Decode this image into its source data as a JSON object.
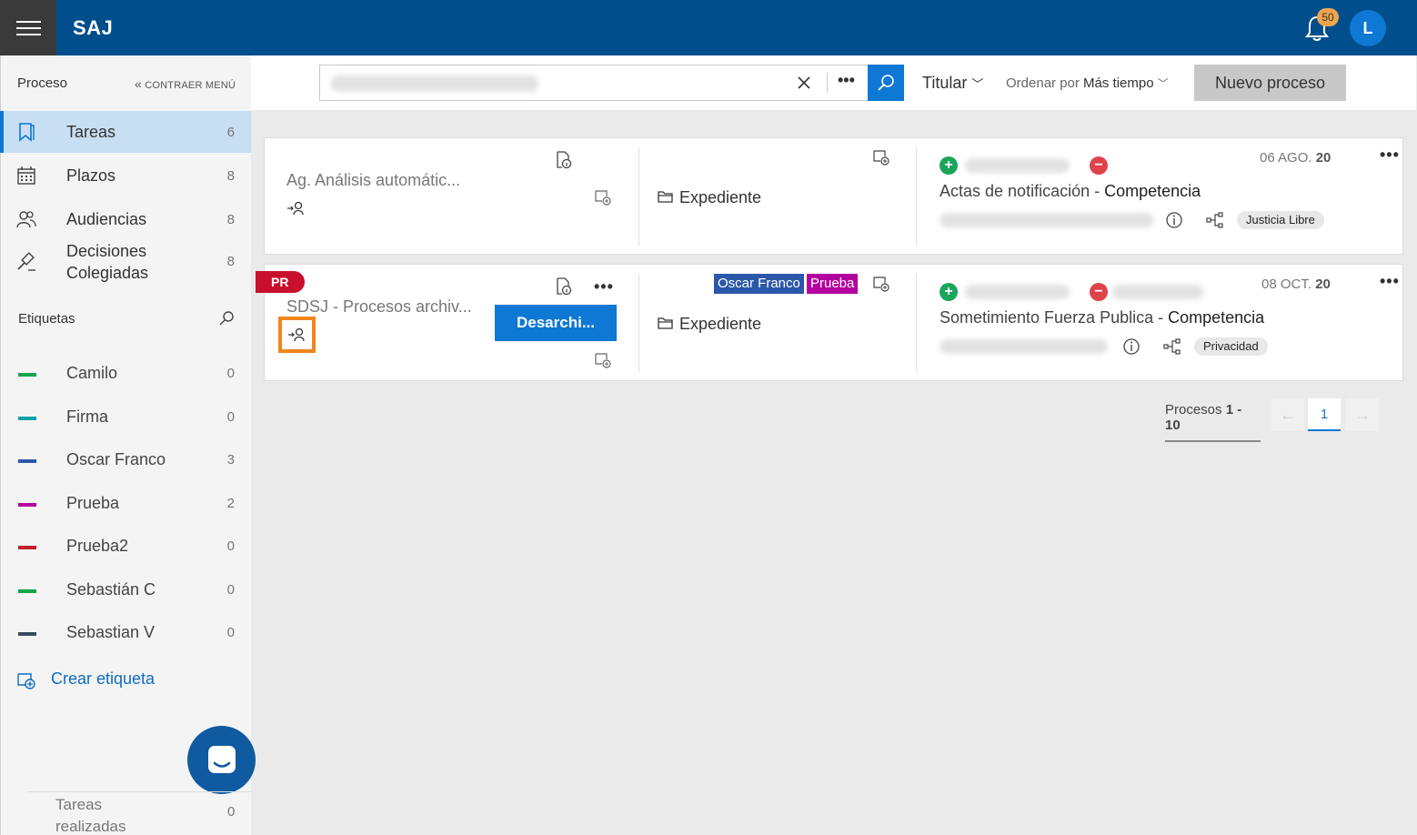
{
  "app": {
    "title": "SAJ",
    "notifications": "50",
    "user_initial": "L"
  },
  "sidebar": {
    "title": "Proceso",
    "collapse": "CONTRAER MENÚ",
    "nav": [
      {
        "label": "Tareas",
        "count": "6",
        "icon": "bookmark-icon"
      },
      {
        "label": "Plazos",
        "count": "8",
        "icon": "calendar-icon"
      },
      {
        "label": "Audiencias",
        "count": "8",
        "icon": "people-icon"
      },
      {
        "label": "Decisiones Colegiadas",
        "line1": "Decisiones",
        "line2": "Colegiadas",
        "count": "8",
        "icon": "gavel-icon"
      }
    ],
    "etiquetas_title": "Etiquetas",
    "tags": [
      {
        "label": "Camilo",
        "count": "0",
        "color": "#16a34a"
      },
      {
        "label": "Firma",
        "count": "0",
        "color": "#0e9fa8"
      },
      {
        "label": "Oscar Franco",
        "count": "3",
        "color": "#2b58a8"
      },
      {
        "label": "Prueba",
        "count": "2",
        "color": "#b4009e"
      },
      {
        "label": "Prueba2",
        "count": "0",
        "color": "#c01f2a"
      },
      {
        "label": "Sebastián C",
        "count": "0",
        "color": "#16a34a"
      },
      {
        "label": "Sebastian V",
        "count": "0",
        "color": "#3b4a5e"
      }
    ],
    "crear": "Crear etiqueta",
    "done_line1": "Tareas",
    "done_line2": "realizadas",
    "done_count": "0"
  },
  "toolbar": {
    "titular": "Titular",
    "ordenar_prefix": "Ordenar por",
    "ordenar_value": "Más tiempo",
    "nuevo": "Nuevo proceso"
  },
  "cards": [
    {
      "title": "Ag. Análisis automátic...",
      "expediente": "Expediente",
      "date_prefix": "06 AGO.",
      "date_year": "20",
      "subject": "Actas de notificación",
      "subject_type": "Competencia",
      "pill": "Justicia Libre"
    },
    {
      "badge": "PR",
      "title": "SDSJ - Procesos archiv...",
      "button": "Desarchi...",
      "tag1": "Oscar Franco",
      "tag2": "Prueba",
      "expediente": "Expediente",
      "date_prefix": "08 OCT.",
      "date_year": "20",
      "subject": "Sometimiento Fuerza Publica",
      "subject_type": "Competencia",
      "pill": "Privacidad"
    }
  ],
  "pagination": {
    "label": "Procesos",
    "range": "1 - 10",
    "page": "1"
  },
  "colors": {
    "brand": "#004e8c",
    "accent": "#0e78d4"
  }
}
